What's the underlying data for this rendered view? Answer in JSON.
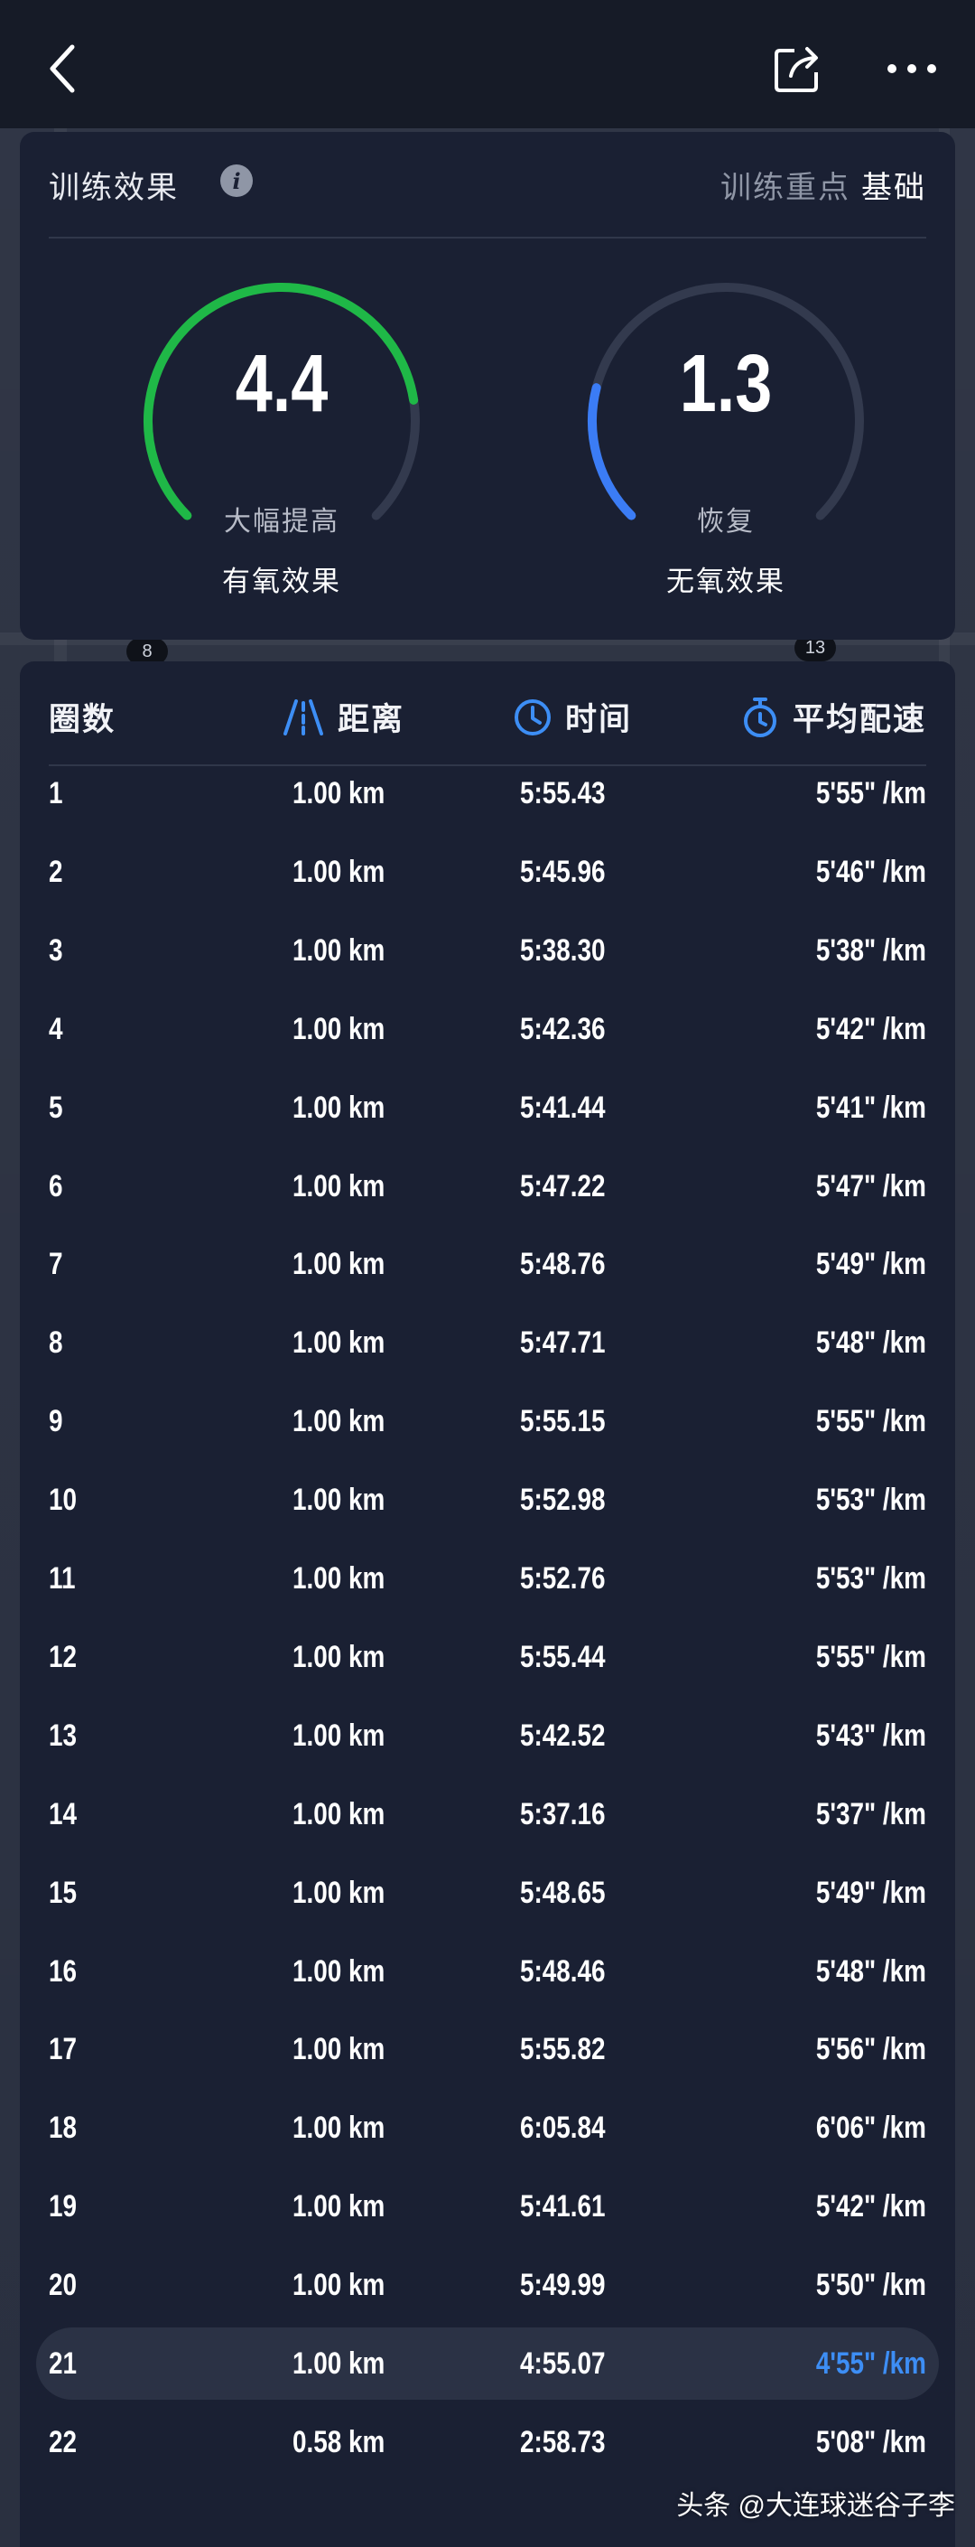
{
  "training_effect": {
    "title": "训练效果",
    "info_icon": "info-icon",
    "focus_label": "训练重点",
    "focus_value": "基础",
    "aerobic": {
      "value": "4.4",
      "level": "大幅提高",
      "caption": "有氧效果",
      "color": "#1fb847",
      "fraction": 0.8
    },
    "anaerobic": {
      "value": "1.3",
      "level": "恢复",
      "caption": "无氧效果",
      "color": "#3b7cf5",
      "fraction": 0.22
    }
  },
  "laps": {
    "headers": {
      "lap": "圈数",
      "distance": "距离",
      "time": "时间",
      "pace": "平均配速"
    },
    "rows": [
      {
        "lap": "1",
        "distance": "1.00 km",
        "time": "5:55.43",
        "pace": "5'55\" /km"
      },
      {
        "lap": "2",
        "distance": "1.00 km",
        "time": "5:45.96",
        "pace": "5'46\" /km"
      },
      {
        "lap": "3",
        "distance": "1.00 km",
        "time": "5:38.30",
        "pace": "5'38\" /km"
      },
      {
        "lap": "4",
        "distance": "1.00 km",
        "time": "5:42.36",
        "pace": "5'42\" /km"
      },
      {
        "lap": "5",
        "distance": "1.00 km",
        "time": "5:41.44",
        "pace": "5'41\" /km"
      },
      {
        "lap": "6",
        "distance": "1.00 km",
        "time": "5:47.22",
        "pace": "5'47\" /km"
      },
      {
        "lap": "7",
        "distance": "1.00 km",
        "time": "5:48.76",
        "pace": "5'49\" /km"
      },
      {
        "lap": "8",
        "distance": "1.00 km",
        "time": "5:47.71",
        "pace": "5'48\" /km"
      },
      {
        "lap": "9",
        "distance": "1.00 km",
        "time": "5:55.15",
        "pace": "5'55\" /km"
      },
      {
        "lap": "10",
        "distance": "1.00 km",
        "time": "5:52.98",
        "pace": "5'53\" /km"
      },
      {
        "lap": "11",
        "distance": "1.00 km",
        "time": "5:52.76",
        "pace": "5'53\" /km"
      },
      {
        "lap": "12",
        "distance": "1.00 km",
        "time": "5:55.44",
        "pace": "5'55\" /km"
      },
      {
        "lap": "13",
        "distance": "1.00 km",
        "time": "5:42.52",
        "pace": "5'43\" /km"
      },
      {
        "lap": "14",
        "distance": "1.00 km",
        "time": "5:37.16",
        "pace": "5'37\" /km"
      },
      {
        "lap": "15",
        "distance": "1.00 km",
        "time": "5:48.65",
        "pace": "5'49\" /km"
      },
      {
        "lap": "16",
        "distance": "1.00 km",
        "time": "5:48.46",
        "pace": "5'48\" /km"
      },
      {
        "lap": "17",
        "distance": "1.00 km",
        "time": "5:55.82",
        "pace": "5'56\" /km"
      },
      {
        "lap": "18",
        "distance": "1.00 km",
        "time": "6:05.84",
        "pace": "6'06\" /km"
      },
      {
        "lap": "19",
        "distance": "1.00 km",
        "time": "5:41.61",
        "pace": "5'42\" /km"
      },
      {
        "lap": "20",
        "distance": "1.00 km",
        "time": "5:49.99",
        "pace": "5'50\" /km"
      },
      {
        "lap": "21",
        "distance": "1.00 km",
        "time": "4:55.07",
        "pace": "4'55\" /km",
        "highlight": true
      },
      {
        "lap": "22",
        "distance": "0.58 km",
        "time": "2:58.73",
        "pace": "5'08\" /km"
      }
    ]
  },
  "map_markers": [
    "8",
    "13"
  ],
  "watermark": "头条 @大连球迷谷子李",
  "colors": {
    "card": "#1a2033",
    "accent_blue": "#3d8ef5",
    "aerobic_green": "#1fb847"
  }
}
